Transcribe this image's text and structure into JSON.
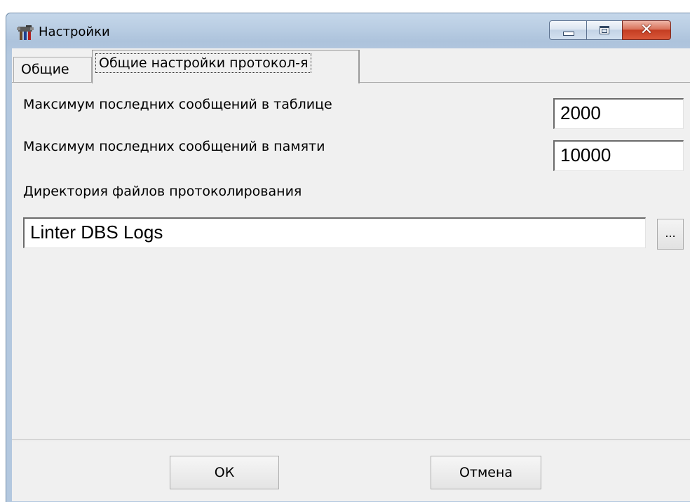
{
  "window": {
    "title": "Настройки"
  },
  "tabs": [
    {
      "label": "Общие",
      "selected": false
    },
    {
      "label": "Общие настройки протокол-я",
      "selected": true
    }
  ],
  "settings": {
    "max_table_label": "Максимум последних сообщений в таблице",
    "max_table_value": "2000",
    "max_memory_label": "Максимум последних сообщений в памяти",
    "max_memory_value": "10000",
    "log_dir_label": "Директория файлов протоколирования",
    "log_dir_value": "Linter DBS Logs",
    "browse_label": "..."
  },
  "buttons": {
    "ok_label": "ОК",
    "cancel_label": "Отмена"
  },
  "colors": {
    "close_button": "#c43d22",
    "titlebar": "#b9cde3",
    "client_background": "#f0f0f0"
  },
  "icons": {
    "app": "settings-tools-icon",
    "minimize": "minimize-icon",
    "maximize": "maximize-icon",
    "close": "close-icon"
  }
}
